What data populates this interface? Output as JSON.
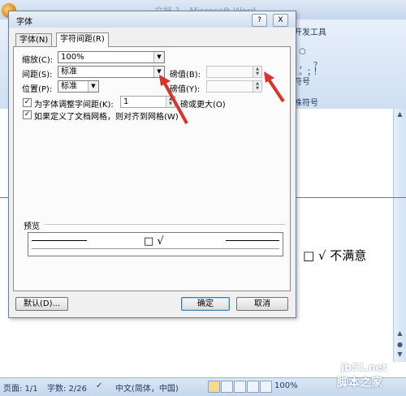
{
  "word": {
    "title": "文档 1 - Microsoft Word",
    "ribbon": {
      "dev_tab": "开发工具",
      "glyphs": [
        "○",
        "，",
        "？",
        "。",
        "；",
        "！"
      ],
      "symbol_label": "符号",
      "special_label": "殊符号"
    },
    "background_text": "□ √ 不满意"
  },
  "status": {
    "page": "页面: 1/1",
    "words": "字数: 2/26",
    "language": "中文(简体，中国)",
    "zoom": "100%"
  },
  "dialog": {
    "title": "字体",
    "help_button": "?",
    "close_button": "X",
    "tabs": [
      "字体(N)",
      "字符间距(R)"
    ],
    "scale_label": "缩放(C):",
    "scale_value": "100%",
    "spacing_label": "间距(S):",
    "spacing_value": "标准",
    "spacing_by_label": "磅值(B):",
    "spacing_by_value": "",
    "position_label": "位置(P):",
    "position_value": "标准",
    "position_by_label": "磅值(Y):",
    "position_by_value": "",
    "kerning_label": "为字体调整字间距(K):",
    "kerning_value": "1",
    "kerning_suffix": "磅或更大(O)",
    "grid_label": "如果定义了文档网格，则对齐到网格(W)",
    "preview_label": "预览",
    "preview_text": "□ √",
    "default_button": "默认(D)...",
    "ok_button": "确定",
    "cancel_button": "取消"
  },
  "watermark": {
    "url": "jb51.net",
    "name": "脚本之家"
  },
  "colors": {
    "arrow": "#d9342b",
    "rule_line": "#d94f4f"
  }
}
